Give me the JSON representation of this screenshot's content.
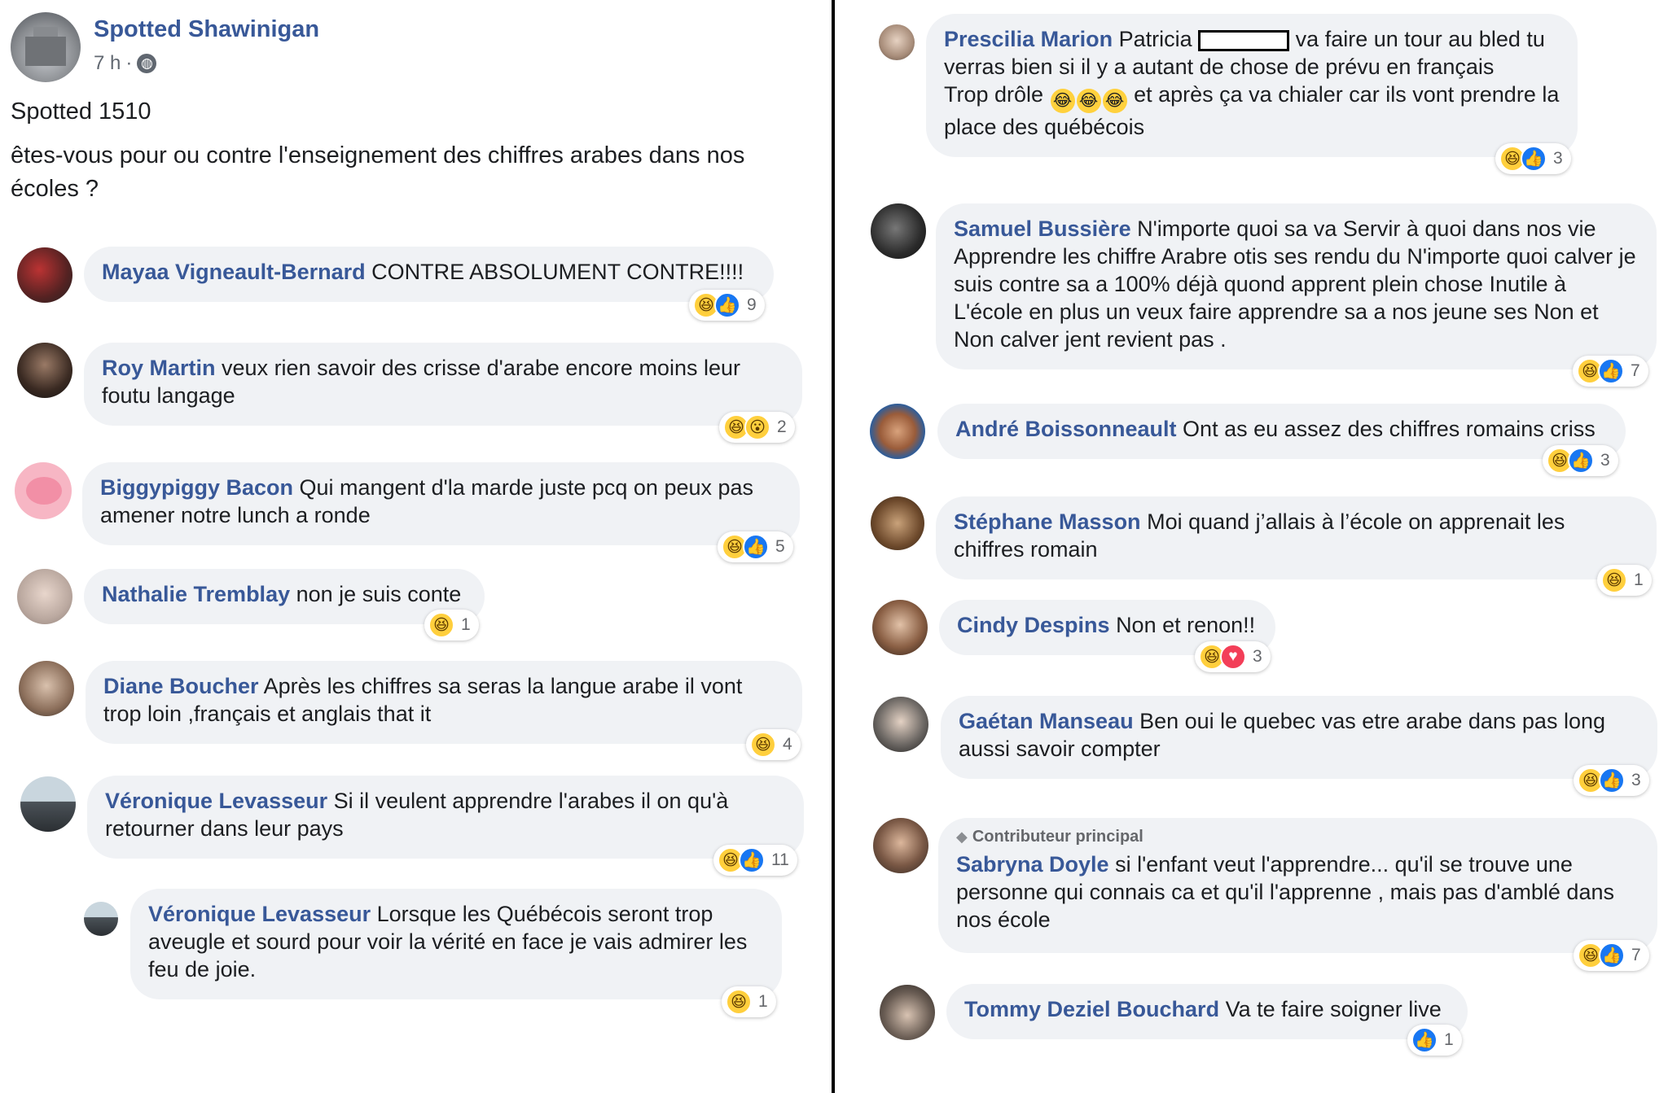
{
  "post": {
    "page_name": "Spotted Shawinigan",
    "time": "7 h",
    "separator": "·",
    "line1": "Spotted 1510",
    "line2": "êtes-vous pour ou contre l'enseignement des chiffres arabes dans nos",
    "line3": "écoles ?"
  },
  "comments": [
    {
      "author": "Mayaa Vigneault-Bernard",
      "text": "CONTRE ABSOLUMENT CONTRE!!!!",
      "reactions": [
        "haha",
        "like"
      ],
      "count": "9"
    },
    {
      "author": "Roy Martin",
      "text": "veux rien savoir des crisse d'arabe encore moins leur foutu langage",
      "reactions": [
        "haha",
        "wow"
      ],
      "count": "2"
    },
    {
      "author": "Biggypiggy Bacon",
      "text": "Qui mangent d'la marde juste pcq on peux pas amener notre lunch a ronde",
      "reactions": [
        "haha",
        "like"
      ],
      "count": "5"
    },
    {
      "author": "Nathalie Tremblay",
      "text": "non je suis conte",
      "reactions": [
        "haha"
      ],
      "count": "1"
    },
    {
      "author": "Diane Boucher",
      "text": "Après les chiffres sa seras la langue arabe il vont trop loin ,français et anglais that it",
      "reactions": [
        "haha"
      ],
      "count": "4"
    },
    {
      "author": "Véronique Levasseur",
      "text": "Si il veulent apprendre l'arabes il on qu'à retourner dans leur pays",
      "reactions": [
        "haha",
        "like"
      ],
      "count": "11"
    },
    {
      "author": "Véronique Levasseur",
      "text": "Lorsque les Québécois seront trop aveugle et sourd pour voir la vérité en face je vais admirer les feu de joie.",
      "reactions": [
        "haha"
      ],
      "count": "1"
    },
    {
      "author": "Prescilia Marion",
      "text_a": "Patricia",
      "text_b": "va faire un tour au bled tu verras bien si il y a autant de chose de prévu en français",
      "text_c": "Trop drôle",
      "text_d": "et après ça va chialer car ils vont prendre la place des québécois",
      "emoji": "😂",
      "reactions": [
        "haha",
        "like"
      ],
      "count": "3"
    },
    {
      "author": "Samuel Bussière",
      "text": "N'importe quoi sa va Servir à quoi dans nos vie Apprendre les chiffre Arabre otis ses rendu du N'importe quoi calver je suis contre sa a 100% déjà quond apprent plein chose Inutile à L'école en plus un veux faire apprendre sa a nos jeune ses Non et Non calver jent revient pas .",
      "reactions": [
        "haha",
        "like"
      ],
      "count": "7"
    },
    {
      "author": "André Boissonneault",
      "text": "Ont as eu assez des chiffres romains criss",
      "reactions": [
        "haha",
        "like"
      ],
      "count": "3"
    },
    {
      "author": "Stéphane Masson",
      "text": "Moi quand j’allais à l’école on apprenait les chiffres romain",
      "reactions": [
        "haha"
      ],
      "count": "1"
    },
    {
      "author": "Cindy Despins",
      "text": "Non et renon!!",
      "reactions": [
        "haha",
        "love"
      ],
      "count": "3"
    },
    {
      "author": "Gaétan Manseau",
      "text": "Ben oui le quebec vas etre arabe dans pas long aussi savoir compter",
      "reactions": [
        "haha",
        "like"
      ],
      "count": "3"
    },
    {
      "author": "Sabryna Doyle",
      "badge": "Contributeur principal",
      "text": "si l'enfant veut l'apprendre... qu'il se trouve une personne qui connais ca et qu'il l'apprenne , mais pas d'amblé dans nos école",
      "reactions": [
        "haha",
        "like"
      ],
      "count": "7"
    },
    {
      "author": "Tommy Deziel Bouchard",
      "text": "Va te faire soigner live",
      "reactions": [
        "like"
      ],
      "count": "1"
    }
  ],
  "icons": {
    "haha": "😆",
    "like": "👍",
    "wow": "😮",
    "love": "♥",
    "globe": "🌐",
    "gem": "◆"
  },
  "colors": {
    "author": "#385898",
    "bubble": "#f0f2f5",
    "like": "#1877f2",
    "haha": "#ffcf3d",
    "love": "#f33e58"
  }
}
